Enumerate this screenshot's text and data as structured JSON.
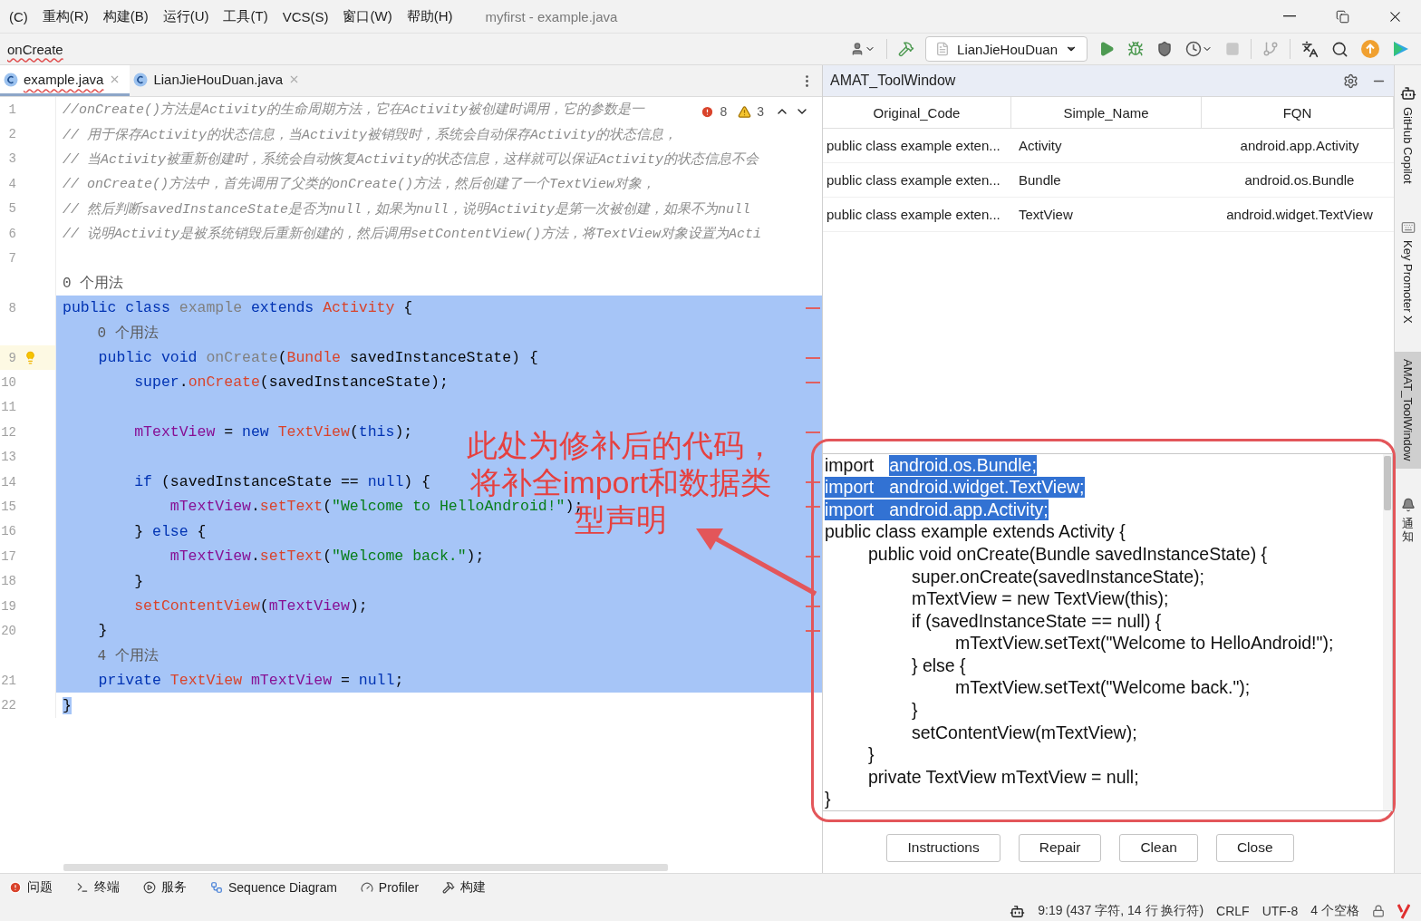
{
  "window": {
    "menus": [
      "(C)",
      "重构(R)",
      "构建(B)",
      "运行(U)",
      "工具(T)",
      "VCS(S)",
      "窗口(W)",
      "帮助(H)"
    ],
    "title": "myfirst - example.java"
  },
  "navbar": {
    "breadcrumb": "onCreate",
    "run_config": "LianJieHouDuan"
  },
  "editor": {
    "tabs": [
      {
        "label": "example.java",
        "selected": true
      },
      {
        "label": "LianJieHouDuan.java",
        "selected": false
      }
    ],
    "inspections": {
      "errors": "8",
      "warnings": "3"
    },
    "rows": [
      {
        "kind": "comment",
        "number": "1",
        "text": "//onCreate()方法是Activity的生命周期方法，它在Activity被创建时调用，它的参数是一",
        "selected": false
      },
      {
        "kind": "comment",
        "number": "2",
        "text": "// 用于保存Activity的状态信息，当Activity被销毁时，系统会自动保存Activity的状态信息，",
        "selected": false
      },
      {
        "kind": "comment",
        "number": "3",
        "text": "// 当Activity被重新创建时，系统会自动恢复Activity的状态信息，这样就可以保证Activity的状态信息不会",
        "selected": false
      },
      {
        "kind": "comment",
        "number": "4",
        "text": "// onCreate()方法中，首先调用了父类的onCreate()方法，然后创建了一个TextView对象，",
        "selected": false
      },
      {
        "kind": "comment",
        "number": "5",
        "text": "// 然后判断savedInstanceState是否为null，如果为null，说明Activity是第一次被创建，如果不为null",
        "selected": false
      },
      {
        "kind": "comment",
        "number": "6",
        "text": "// 说明Activity是被系统销毁后重新创建的，然后调用setContentView()方法，将TextView对象设置为Acti",
        "selected": false
      },
      {
        "kind": "code",
        "number": "7",
        "tokens": [],
        "selected": false
      },
      {
        "kind": "usage",
        "text": "0 个用法",
        "selected": false
      },
      {
        "kind": "code",
        "number": "8",
        "tokens": [
          {
            "text": "public class ",
            "kind": "keyword"
          },
          {
            "text": "example ",
            "kind": "unused"
          },
          {
            "text": "extends ",
            "kind": "keyword"
          },
          {
            "text": "Activity",
            "kind": "error"
          },
          {
            "text": " {",
            "kind": "plain"
          }
        ],
        "selected": true,
        "error_mark": true
      },
      {
        "kind": "usage",
        "text": "    0 个用法",
        "selected": true
      },
      {
        "kind": "code",
        "number": "9",
        "tokens": [
          {
            "text": "    public void ",
            "kind": "keyword"
          },
          {
            "text": "onCreate",
            "kind": "unused"
          },
          {
            "text": "(",
            "kind": "plain"
          },
          {
            "text": "Bundle",
            "kind": "error"
          },
          {
            "text": " savedInstanceState) {",
            "kind": "plain"
          }
        ],
        "selected": true,
        "error_mark": true,
        "bulb": true
      },
      {
        "kind": "code",
        "number": "10",
        "tokens": [
          {
            "text": "        super",
            "kind": "keyword"
          },
          {
            "text": ".",
            "kind": "plain"
          },
          {
            "text": "onCreate",
            "kind": "error"
          },
          {
            "text": "(savedInstanceState);",
            "kind": "plain"
          }
        ],
        "selected": true,
        "error_mark": true
      },
      {
        "kind": "code",
        "number": "11",
        "tokens": [],
        "selected": true
      },
      {
        "kind": "code",
        "number": "12",
        "tokens": [
          {
            "text": "        mTextView",
            "kind": "field"
          },
          {
            "text": " = ",
            "kind": "plain"
          },
          {
            "text": "new ",
            "kind": "keyword"
          },
          {
            "text": "TextView",
            "kind": "error"
          },
          {
            "text": "(",
            "kind": "plain"
          },
          {
            "text": "this",
            "kind": "keyword"
          },
          {
            "text": ");",
            "kind": "plain"
          }
        ],
        "selected": true,
        "error_mark": true
      },
      {
        "kind": "code",
        "number": "13",
        "tokens": [],
        "selected": true
      },
      {
        "kind": "code",
        "number": "14",
        "tokens": [
          {
            "text": "        if ",
            "kind": "keyword"
          },
          {
            "text": "(savedInstanceState == ",
            "kind": "plain"
          },
          {
            "text": "null",
            "kind": "keyword"
          },
          {
            "text": ") {",
            "kind": "plain"
          }
        ],
        "selected": true,
        "error_mark": true
      },
      {
        "kind": "code",
        "number": "15",
        "tokens": [
          {
            "text": "            mTextView",
            "kind": "field"
          },
          {
            "text": ".",
            "kind": "plain"
          },
          {
            "text": "setText",
            "kind": "error"
          },
          {
            "text": "(",
            "kind": "plain"
          },
          {
            "text": "\"Welcome to HelloAndroid!\"",
            "kind": "string"
          },
          {
            "text": ");",
            "kind": "plain"
          }
        ],
        "selected": true,
        "error_mark": true
      },
      {
        "kind": "code",
        "number": "16",
        "tokens": [
          {
            "text": "        } ",
            "kind": "plain"
          },
          {
            "text": "else ",
            "kind": "keyword"
          },
          {
            "text": "{",
            "kind": "plain"
          }
        ],
        "selected": true
      },
      {
        "kind": "code",
        "number": "17",
        "tokens": [
          {
            "text": "            mTextView",
            "kind": "field"
          },
          {
            "text": ".",
            "kind": "plain"
          },
          {
            "text": "setText",
            "kind": "error"
          },
          {
            "text": "(",
            "kind": "plain"
          },
          {
            "text": "\"Welcome back.\"",
            "kind": "string"
          },
          {
            "text": ");",
            "kind": "plain"
          }
        ],
        "selected": true,
        "error_mark": true
      },
      {
        "kind": "code",
        "number": "18",
        "tokens": [
          {
            "text": "        }",
            "kind": "plain"
          }
        ],
        "selected": true
      },
      {
        "kind": "code",
        "number": "19",
        "tokens": [
          {
            "text": "        setContentView",
            "kind": "error"
          },
          {
            "text": "(",
            "kind": "plain"
          },
          {
            "text": "mTextView",
            "kind": "field"
          },
          {
            "text": ");",
            "kind": "plain"
          }
        ],
        "selected": true,
        "error_mark": true
      },
      {
        "kind": "code",
        "number": "20",
        "tokens": [
          {
            "text": "    }",
            "kind": "plain"
          }
        ],
        "selected": true,
        "error_mark": true
      },
      {
        "kind": "usage",
        "text": "    4 个用法",
        "selected": true
      },
      {
        "kind": "code",
        "number": "21",
        "tokens": [
          {
            "text": "    private ",
            "kind": "keyword"
          },
          {
            "text": "TextView ",
            "kind": "error"
          },
          {
            "text": "mTextView",
            "kind": "field"
          },
          {
            "text": " = ",
            "kind": "plain"
          },
          {
            "text": "null",
            "kind": "keyword"
          },
          {
            "text": ";",
            "kind": "plain"
          }
        ],
        "selected": true
      },
      {
        "kind": "code",
        "number": "22",
        "tokens": [
          {
            "text": "}",
            "kind": "plain"
          }
        ],
        "selected": false,
        "text_selected": true
      }
    ]
  },
  "annotation": {
    "lines": [
      "此处为修补后的代码，",
      "将补全import和数据类",
      "型声明"
    ]
  },
  "tool_window": {
    "title": "AMAT_ToolWindow",
    "columns": [
      "Original_Code",
      "Simple_Name",
      "FQN"
    ],
    "rows": [
      [
        "public class example exten...",
        "Activity",
        "android.app.Activity"
      ],
      [
        "public class example exten...",
        "Bundle",
        "android.os.Bundle"
      ],
      [
        "public class example exten...",
        "TextView",
        "android.widget.TextView"
      ]
    ],
    "code_lines": [
      {
        "segments": [
          {
            "text": "import",
            "selected": false
          },
          {
            "text": "android.os.Bundle;",
            "selected": true
          }
        ]
      },
      {
        "segments": [
          {
            "text": "import",
            "selected": true
          },
          {
            "text": "android.widget.TextView;",
            "selected": true
          }
        ]
      },
      {
        "segments": [
          {
            "text": "import",
            "selected": true
          },
          {
            "text": "android.app.Activity;",
            "selected": true
          }
        ]
      },
      {
        "segments": [
          {
            "text": "public class example extends Activity {",
            "selected": false
          }
        ]
      },
      {
        "segments": [
          {
            "text": "\tpublic void onCreate(Bundle savedInstanceState) {",
            "selected": false
          }
        ]
      },
      {
        "segments": [
          {
            "text": "\t\tsuper.onCreate(savedInstanceState);",
            "selected": false
          }
        ]
      },
      {
        "segments": [
          {
            "text": "\t\tmTextView = new TextView(this);",
            "selected": false
          }
        ]
      },
      {
        "segments": [
          {
            "text": "\t\tif (savedInstanceState == null) {",
            "selected": false
          }
        ]
      },
      {
        "segments": [
          {
            "text": "\t\t\tmTextView.setText(\"Welcome to HelloAndroid!\");",
            "selected": false
          }
        ]
      },
      {
        "segments": [
          {
            "text": "\t\t} else {",
            "selected": false
          }
        ]
      },
      {
        "segments": [
          {
            "text": "\t\t\tmTextView.setText(\"Welcome back.\");",
            "selected": false
          }
        ]
      },
      {
        "segments": [
          {
            "text": "\t\t}",
            "selected": false
          }
        ]
      },
      {
        "segments": [
          {
            "text": "\t\tsetContentView(mTextView);",
            "selected": false
          }
        ]
      },
      {
        "segments": [
          {
            "text": "\t}",
            "selected": false
          }
        ]
      },
      {
        "segments": [
          {
            "text": "\tprivate TextView mTextView = null;",
            "selected": false
          }
        ]
      },
      {
        "segments": [
          {
            "text": "}",
            "selected": false
          }
        ]
      }
    ],
    "buttons": [
      "Instructions",
      "Repair",
      "Clean",
      "Close"
    ]
  },
  "side_strip": [
    {
      "label": "GitHub Copilot",
      "kind": "rotated",
      "selected": false
    },
    {
      "label": "Key Promoter X",
      "kind": "rotated",
      "selected": false
    },
    {
      "label": "AMAT_ToolWindow",
      "kind": "rotated",
      "selected": true
    },
    {
      "label": "通知",
      "kind": "stacked",
      "selected": false
    }
  ],
  "bottom_tools": [
    {
      "label": "问题",
      "kind": "problems"
    },
    {
      "label": "终端",
      "kind": "terminal"
    },
    {
      "label": "服务",
      "kind": "services"
    },
    {
      "label": "Sequence Diagram",
      "kind": "diagram"
    },
    {
      "label": "Profiler",
      "kind": "profiler"
    },
    {
      "label": "构建",
      "kind": "build"
    }
  ],
  "status": [
    "9:19 (437 字符, 14 行 换行符)",
    "CRLF",
    "UTF-8",
    "4 个空格"
  ]
}
